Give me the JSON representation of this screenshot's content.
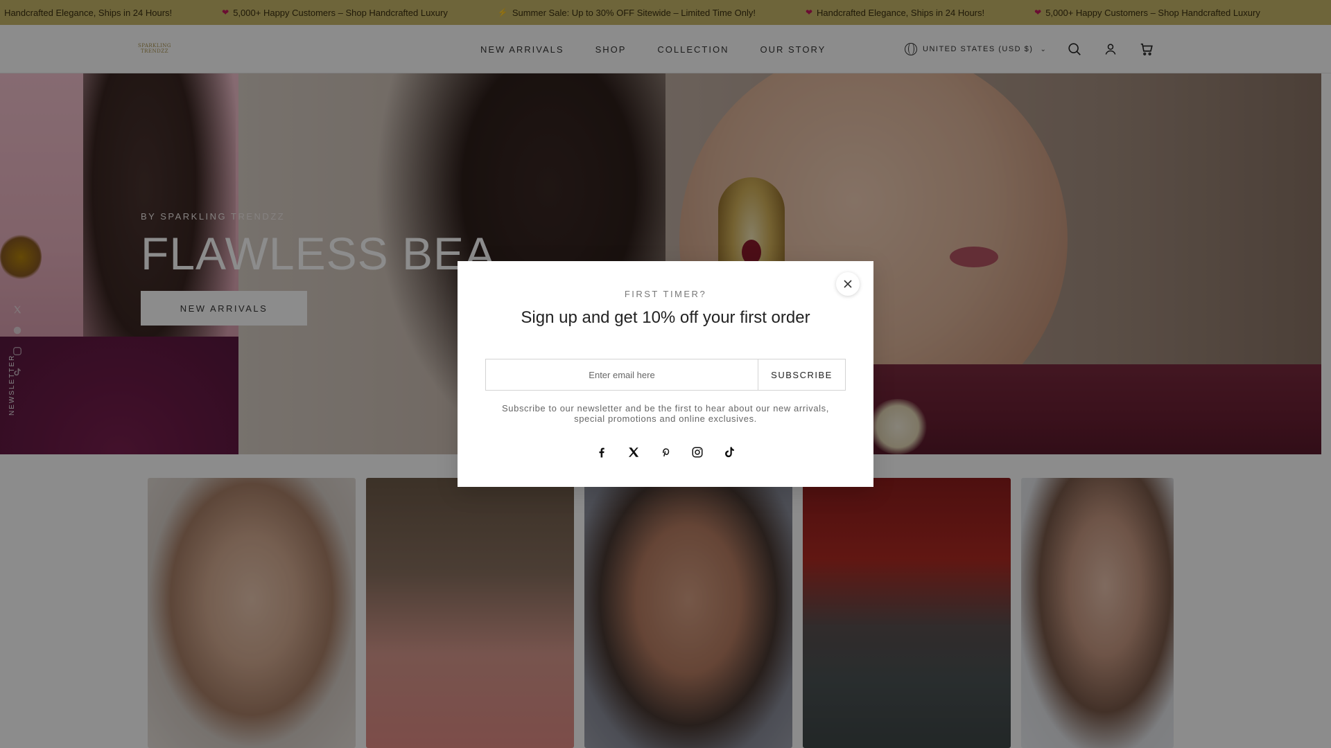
{
  "announcement": {
    "items": [
      {
        "icon": "heart-icon",
        "text": "Handcrafted Elegance, Ships in 24 Hours!"
      },
      {
        "icon": "heart-icon",
        "text": "5,000+ Happy Customers – Shop Handcrafted Luxury"
      },
      {
        "icon": "bolt-icon",
        "text": "Summer Sale: Up to 30% OFF Sitewide – Limited Time Only!"
      },
      {
        "icon": "heart-icon",
        "text": "Handcrafted Elegance, Ships in 24 Hours!"
      },
      {
        "icon": "heart-icon",
        "text": "5,000+ Happy Customers – Shop Handcrafted Luxury"
      }
    ],
    "background": "#c9b86a"
  },
  "header": {
    "logo_text": "SPARKLING TRENDZZ",
    "nav": [
      "NEW ARRIVALS",
      "SHOP",
      "COLLECTION",
      "OUR STORY"
    ],
    "country_label": "UNITED STATES (USD $)",
    "icons": [
      "search-icon",
      "account-icon",
      "cart-icon"
    ]
  },
  "hero": {
    "kicker": "BY SPARKLING TRENDZZ",
    "title": "FLAWLESS BEA",
    "button_label": "NEW ARRIVALS"
  },
  "sidebar": {
    "newsletter_label": "NEWSLETTER",
    "icons": [
      "x-icon",
      "pinterest-icon",
      "instagram-icon",
      "tiktok-icon"
    ]
  },
  "gallery": {
    "cards": [
      "card-1",
      "card-2",
      "card-3",
      "card-4",
      "card-5"
    ]
  },
  "modal": {
    "kicker": "FIRST TIMER?",
    "title": "Sign up and get 10% off your first order",
    "email_placeholder": "Enter email here",
    "email_value": "",
    "submit_label": "SUBSCRIBE",
    "note": "Subscribe to our newsletter and be the first to hear about our new arrivals, special promotions and online exclusives.",
    "socials": [
      "facebook-icon",
      "x-icon",
      "pinterest-icon",
      "instagram-icon",
      "tiktok-icon"
    ]
  }
}
